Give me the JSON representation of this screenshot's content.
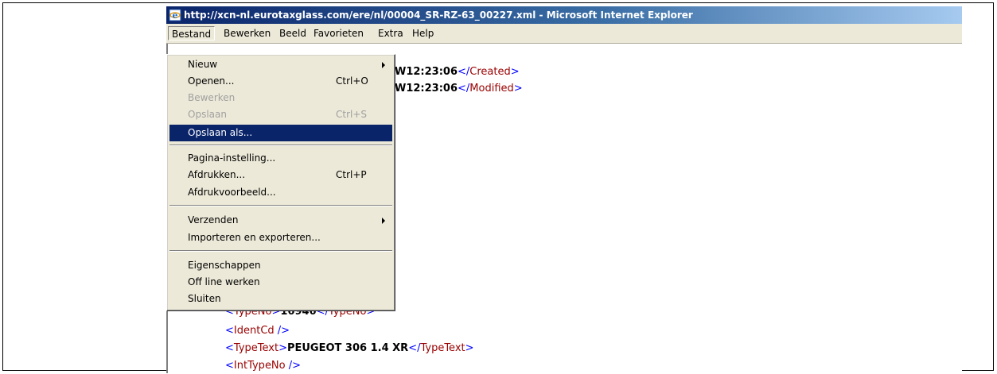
{
  "window": {
    "title": "http://xcn-nl.eurotaxglass.com/ere/nl/00004_SR-RZ-63_00227.xml - Microsoft Internet Explorer",
    "icon": "ie-icon"
  },
  "menubar": {
    "items": [
      "Bestand",
      "Bewerken",
      "Beeld",
      "Favorieten",
      "Extra",
      "Help"
    ],
    "active": "Bestand"
  },
  "file_menu": {
    "new": {
      "label": "Nieuw",
      "submenu": true
    },
    "open": {
      "label": "Openen...",
      "shortcut": "Ctrl+O"
    },
    "edit": {
      "label": "Bewerken",
      "disabled": true
    },
    "save": {
      "label": "Opslaan",
      "shortcut": "Ctrl+S",
      "disabled": true
    },
    "save_as": {
      "label": "Opslaan als...",
      "selected": true
    },
    "page_setup": {
      "label": "Pagina-instelling..."
    },
    "print": {
      "label": "Afdrukken...",
      "shortcut": "Ctrl+P"
    },
    "print_preview": {
      "label": "Afdrukvoorbeeld..."
    },
    "send": {
      "label": "Verzenden",
      "submenu": true
    },
    "import_export": {
      "label": "Importeren en exporteren..."
    },
    "properties": {
      "label": "Eigenschappen"
    },
    "offline": {
      "label": "Off line werken"
    },
    "close": {
      "label": "Sluiten"
    }
  },
  "xml": {
    "created": {
      "value_partial": "W12:23:06",
      "close_tag": "Created"
    },
    "modified": {
      "value_partial": "W12:23:06",
      "close_tag": "Modified"
    },
    "typeno": {
      "open_tag_partial": "TypeNo",
      "value_partial": "16946",
      "close_tag": "TypeNo"
    },
    "identcd": {
      "tag": "IdentCd"
    },
    "typetext": {
      "tag": "TypeText",
      "value": "PEUGEOT 306 1.4 XR"
    },
    "inttypeno": {
      "tag": "IntTypeNo"
    }
  }
}
